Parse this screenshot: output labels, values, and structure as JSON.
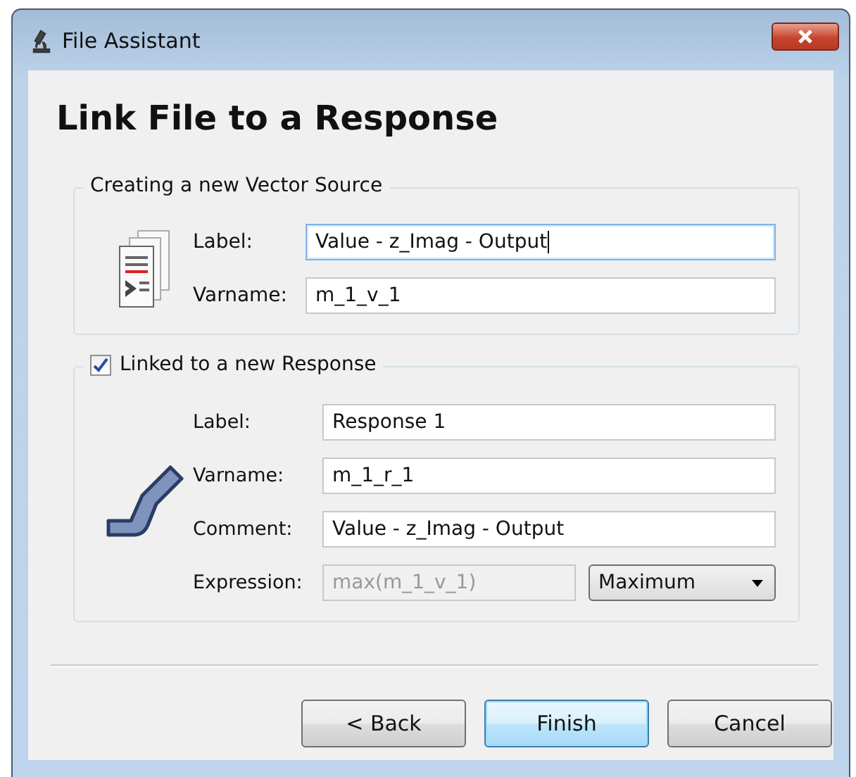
{
  "window": {
    "title": "File Assistant"
  },
  "heading": "Link File to a Response",
  "vector_source": {
    "title": "Creating a new Vector Source",
    "fields": [
      {
        "label": "Label:",
        "value": "Value - z_Imag - Output",
        "focused": true
      },
      {
        "label": "Varname:",
        "value": "m_1_v_1",
        "focused": false
      }
    ]
  },
  "response": {
    "title": "Linked to a new Response",
    "checked": true,
    "fields": [
      {
        "kind": "text",
        "label": "Label:",
        "value": "Response 1",
        "disabled": false
      },
      {
        "kind": "text",
        "label": "Varname:",
        "value": "m_1_r_1",
        "disabled": false
      },
      {
        "kind": "text",
        "label": "Comment:",
        "value": "Value - z_Imag - Output",
        "disabled": false
      },
      {
        "kind": "expression",
        "label": "Expression:",
        "value": "max(m_1_v_1)",
        "disabled": true,
        "combo": "Maximum"
      }
    ]
  },
  "buttons": [
    {
      "label": "< Back",
      "default": false
    },
    {
      "label": "Finish",
      "default": true
    },
    {
      "label": "Cancel",
      "default": false
    }
  ]
}
